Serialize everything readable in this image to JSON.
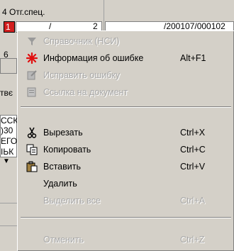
{
  "background": {
    "header_text": "4 Отг.спец.",
    "field_value": "1",
    "field_mid": "/",
    "field_num": "2",
    "record_path": "/200107/000102",
    "left_digit": "6",
    "col_label": "твє",
    "row_lines": [
      "ССК",
      ")30",
      "ЕГО",
      "ІЬК"
    ],
    "filter_glyph": "▼"
  },
  "menu": {
    "items": [
      {
        "label": "Справочник (НСИ)",
        "shortcut": "",
        "disabled": true,
        "icon": "filter-funnel-icon"
      },
      {
        "label": "Информация об ошибке",
        "shortcut": "Alt+F1",
        "disabled": false,
        "icon": "red-star-icon"
      },
      {
        "label": "Исправить ошибку",
        "shortcut": "",
        "disabled": true,
        "icon": "fix-error-icon"
      },
      {
        "label": "Ссылка на документ",
        "shortcut": "",
        "disabled": true,
        "icon": "document-link-icon"
      },
      {
        "label": "Вырезать",
        "shortcut": "Ctrl+X",
        "disabled": false,
        "icon": "scissors-icon"
      },
      {
        "label": "Копировать",
        "shortcut": "Ctrl+C",
        "disabled": false,
        "icon": "copy-icon"
      },
      {
        "label": "Вставить",
        "shortcut": "Ctrl+V",
        "disabled": false,
        "icon": "paste-icon"
      },
      {
        "label": "Удалить",
        "shortcut": "",
        "disabled": false,
        "icon": ""
      },
      {
        "label": "Выделить все",
        "shortcut": "Ctrl+A",
        "disabled": true,
        "icon": ""
      },
      {
        "label": "Отменить",
        "shortcut": "Ctrl+Z",
        "disabled": true,
        "icon": ""
      }
    ]
  },
  "colors": {
    "menu_bg": "#d4d0c8",
    "disabled_text": "#a8a8a8",
    "accent_red": "#d21f1f"
  }
}
